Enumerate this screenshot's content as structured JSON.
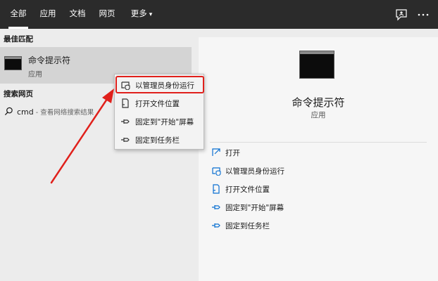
{
  "tabs": [
    {
      "label": "全部",
      "active": true
    },
    {
      "label": "应用",
      "active": false
    },
    {
      "label": "文档",
      "active": false
    },
    {
      "label": "网页",
      "active": false
    },
    {
      "label": "更多",
      "active": false
    }
  ],
  "topbar": {
    "feedback_icon": "feedback-icon",
    "more_icon": "ellipsis-icon",
    "more_caret": "▾"
  },
  "left": {
    "best_match_heading": "最佳匹配",
    "best_item": {
      "title": "命令提示符",
      "subtitle": "应用",
      "icon": "command-prompt-icon"
    },
    "web_heading": "搜索网页",
    "web_query": "cmd",
    "web_hint": " - 查看网络搜索结果"
  },
  "context_menu": {
    "items": [
      {
        "label": "以管理员身份运行",
        "icon": "shield-run-icon"
      },
      {
        "label": "打开文件位置",
        "icon": "file-location-icon"
      },
      {
        "label": "固定到\"开始\"屏幕",
        "icon": "pin-icon"
      },
      {
        "label": "固定到任务栏",
        "icon": "pin-icon"
      }
    ],
    "highlight_color": "#e0201b"
  },
  "preview": {
    "title": "命令提示符",
    "subtitle": "应用",
    "actions": [
      {
        "label": "打开",
        "icon": "open-icon"
      },
      {
        "label": "以管理员身份运行",
        "icon": "shield-run-icon"
      },
      {
        "label": "打开文件位置",
        "icon": "file-location-icon"
      },
      {
        "label": "固定到\"开始\"屏幕",
        "icon": "pin-icon"
      },
      {
        "label": "固定到任务栏",
        "icon": "pin-icon"
      }
    ],
    "accent_color": "#0a6fd1"
  },
  "annotation": {
    "arrow_color": "#e0201b"
  }
}
